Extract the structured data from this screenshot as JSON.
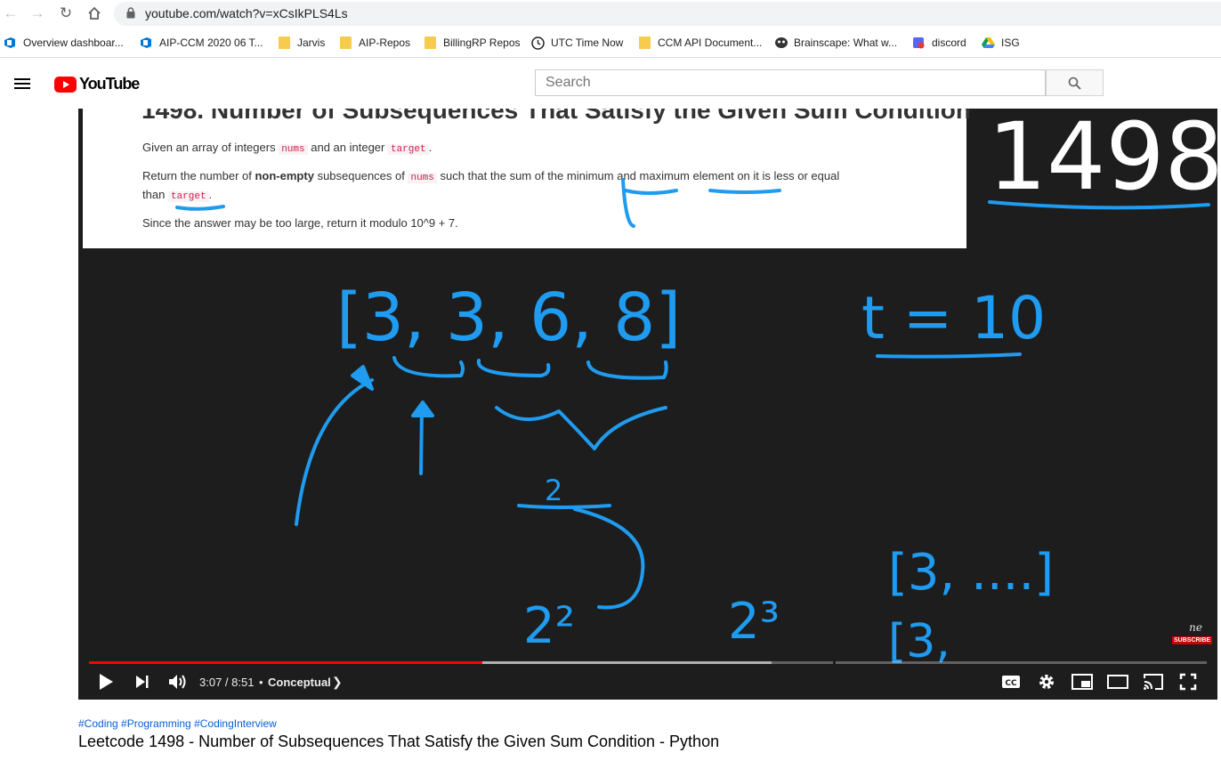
{
  "browser": {
    "url": "youtube.com/watch?v=xCsIkPLS4Ls",
    "bookmarks": [
      {
        "label": "Overview dashboar...",
        "icon": "azure-devops-icon"
      },
      {
        "label": "AIP-CCM 2020 06 T...",
        "icon": "azure-devops-icon"
      },
      {
        "label": "Jarvis",
        "icon": "folder-icon"
      },
      {
        "label": "AIP-Repos",
        "icon": "folder-icon"
      },
      {
        "label": "BillingRP Repos",
        "icon": "folder-icon"
      },
      {
        "label": "UTC Time Now",
        "icon": "clock-icon"
      },
      {
        "label": "CCM API Document...",
        "icon": "folder-icon"
      },
      {
        "label": "Brainscape: What w...",
        "icon": "brainscape-icon"
      },
      {
        "label": "discord",
        "icon": "discord-icon"
      },
      {
        "label": "ISG",
        "icon": "google-drive-icon"
      }
    ]
  },
  "youtube": {
    "logo_text": "YouTube",
    "search_placeholder": "Search"
  },
  "video_frame": {
    "problem_title": "1498. Number of Subsequences That Satisfy the Given Sum Condition",
    "line1_a": "Given an array of integers",
    "line1_code1": "nums",
    "line1_b": "and an integer",
    "line1_code2": "target",
    "line1_c": ".",
    "line2_a": "Return the number of",
    "line2_bold": "non-empty",
    "line2_b": "subsequences of",
    "line2_code": "nums",
    "line2_c": "such that the sum of the minimum and maximum element on it is less or equal",
    "line3_a": "than",
    "line3_code": "target",
    "line3_b": ".",
    "line4": "Since the answer may be too large, return it modulo 10^9 + 7.",
    "handwritten": {
      "number": "1498",
      "array": "[3, 3, 6, 8]",
      "target": "t = 10",
      "count": "2",
      "pow1": "2²",
      "pow2": "2³",
      "sub1": "[3, ....]",
      "sub2": "[3,"
    },
    "badge_logo": "ne",
    "badge_text": "SUBSCRIBE"
  },
  "player": {
    "current_time": "3:07",
    "duration": "8:51",
    "time_display": "3:07 / 8:51",
    "separator": "•",
    "chapter": "Conceptual",
    "played_fraction": 0.352,
    "buffered_fraction": 0.611,
    "colors": {
      "progress": "#ff0000",
      "background": "#1d1d1d"
    }
  },
  "video_info": {
    "hashtags": "#Coding #Programming #CodingInterview",
    "title": "Leetcode 1498 - Number of Subsequences That Satisfy the Given Sum Condition - Python"
  }
}
